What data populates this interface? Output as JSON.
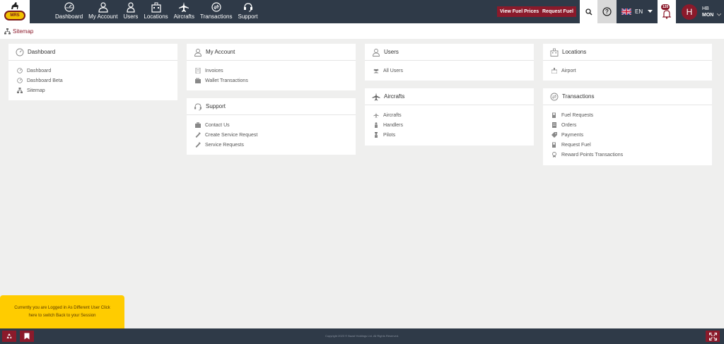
{
  "logo": {
    "text": "MRS"
  },
  "nav": [
    {
      "label": "Dashboard",
      "icon": "dashboard-icon"
    },
    {
      "label": "My Account",
      "icon": "user-icon"
    },
    {
      "label": "Users",
      "icon": "users-icon"
    },
    {
      "label": "Locations",
      "icon": "building-icon"
    },
    {
      "label": "Aircrafts",
      "icon": "plane-icon"
    },
    {
      "label": "Transactions",
      "icon": "exchange-icon"
    },
    {
      "label": "Support",
      "icon": "headset-icon"
    }
  ],
  "header_buttons": {
    "fuel_prices": "View Fuel Prices",
    "request_fuel": "Request Fuel"
  },
  "language": "EN",
  "notifications": {
    "count": "120"
  },
  "user": {
    "initial": "H",
    "name": "HB",
    "org": "MON"
  },
  "breadcrumb": {
    "label": "Sitemap"
  },
  "cards": {
    "dashboard": {
      "title": "Dashboard",
      "items": [
        "Dashboard",
        "Dashboard Beta",
        "Sitemap"
      ]
    },
    "my_account": {
      "title": "My Account",
      "items": [
        "Invoices",
        "Wallet Transactions"
      ]
    },
    "support": {
      "title": "Support",
      "items": [
        "Contact Us",
        "Create Service Request",
        "Service Requests"
      ]
    },
    "users": {
      "title": "Users",
      "items": [
        "All Users"
      ]
    },
    "aircrafts": {
      "title": "Aircrafts",
      "items": [
        "Aircrafts",
        "Handlers",
        "Pilots"
      ]
    },
    "locations": {
      "title": "Locations",
      "items": [
        "Airport"
      ]
    },
    "transactions": {
      "title": "Transactions",
      "items": [
        "Fuel Requests",
        "Orders",
        "Payments",
        "Request Fuel",
        "Reward Points Transactions"
      ]
    }
  },
  "notice": {
    "line1": "Currently you are Logged in As Different User Click",
    "line2": "here to switch Back to your Session"
  },
  "footer": {
    "copyright": "Copyright 2023 © Bazaf Holdings Ltd. All Rights Reserved."
  },
  "colors": {
    "topbar": "#2f3a48",
    "accent": "#8b1a2b",
    "notice": "#ffcc00",
    "background": "#efefee"
  }
}
